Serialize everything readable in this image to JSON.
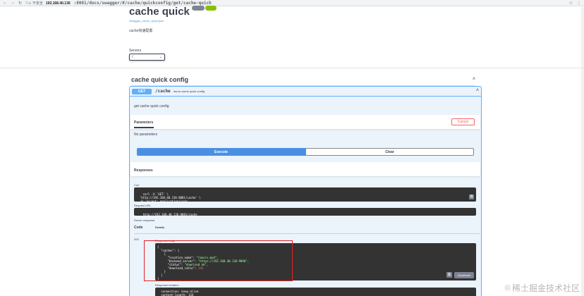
{
  "browser": {
    "nav_icons": [
      "←",
      "→",
      "↻",
      "⌂"
    ],
    "security_label": "不安全",
    "url_host": "192.168.40.136",
    "url_path": ":8081/docs/swagger/#/cache/quickconfig/get/cache-quick",
    "right_icons": [
      "☆",
      "⋮"
    ]
  },
  "info": {
    "title": "cache quick",
    "spec_link": "/swagger_cache_quick.json",
    "description": "cache快速配置"
  },
  "servers": {
    "label": "Servers",
    "selected": "/"
  },
  "tag": {
    "name": "cache quick config",
    "chevron": "˄"
  },
  "operation": {
    "method": "GET",
    "path": "/cache",
    "summary": "return cache quick config",
    "chevron": "˄",
    "description": "get cache quick config",
    "parameters_tab": "Parameters",
    "cancel_label": "Cancel",
    "no_params": "No parameters",
    "execute_label": "Execute",
    "clear_label": "Clear",
    "responses_title": "Responses",
    "curl_label": "Curl",
    "curl_code": "curl -X 'GET' \\\n  'http://192.168.40.136:8081/cache' \\\n  -H 'accept: application/json'",
    "request_url_label": "Request URL",
    "request_url": "http://192.168.40.136:8081/cache",
    "server_response_label": "Server response",
    "code_col": "Code",
    "details_col": "Details",
    "status_code": "200",
    "response_body_label": "Response body",
    "response_body": {
      "open": "{",
      "caches_key": "  \"caches\": [",
      "obj_open": "    {",
      "location_name_key": "      \"location_name\": ",
      "location_name_val": "\"rmasis.mp4\",",
      "backend_server_key": "      \"backend_server\": ",
      "backend_server_val": "\"https://192.168.40.136:9090\",",
      "status_key": "      \"status\": ",
      "status_val": "\"download ok\",",
      "ratio_key": "      \"download_ratio\": ",
      "ratio_val": "100",
      "obj_close": "    }",
      "arr_close": "  ]",
      "close": "}"
    },
    "download_label": "Download",
    "response_headers_label": "Response headers",
    "response_headers": " connection: keep-alive\n content-length: 134"
  },
  "watermark": "稀土掘金技术社区"
}
